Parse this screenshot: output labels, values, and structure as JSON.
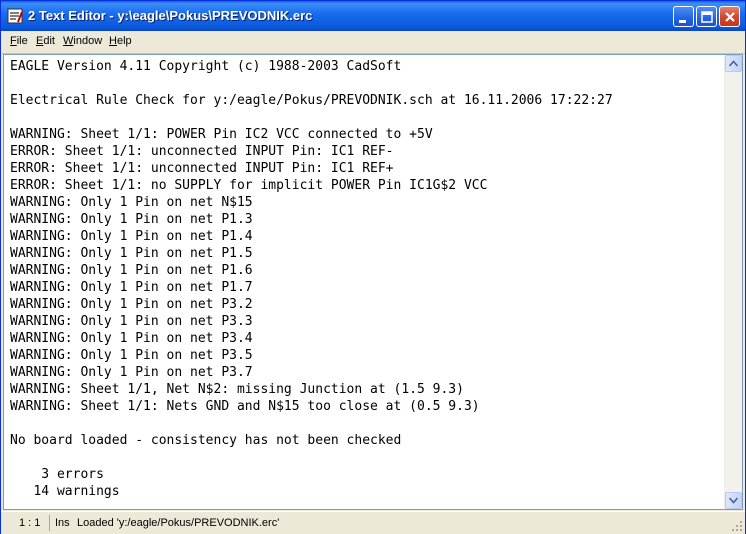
{
  "window": {
    "title": "2 Text Editor - y:\\eagle\\Pokus\\PREVODNIK.erc"
  },
  "menubar": [
    {
      "key": "F",
      "rest": "ile"
    },
    {
      "key": "E",
      "rest": "dit"
    },
    {
      "key": "W",
      "rest": "indow"
    },
    {
      "key": "H",
      "rest": "elp"
    }
  ],
  "editor": {
    "lines": [
      "EAGLE Version 4.11 Copyright (c) 1988-2003 CadSoft",
      "",
      "Electrical Rule Check for y:/eagle/Pokus/PREVODNIK.sch at 16.11.2006 17:22:27",
      "",
      "WARNING: Sheet 1/1: POWER Pin IC2 VCC connected to +5V",
      "ERROR: Sheet 1/1: unconnected INPUT Pin: IC1 REF-",
      "ERROR: Sheet 1/1: unconnected INPUT Pin: IC1 REF+",
      "ERROR: Sheet 1/1: no SUPPLY for implicit POWER Pin IC1G$2 VCC",
      "WARNING: Only 1 Pin on net N$15",
      "WARNING: Only 1 Pin on net P1.3",
      "WARNING: Only 1 Pin on net P1.4",
      "WARNING: Only 1 Pin on net P1.5",
      "WARNING: Only 1 Pin on net P1.6",
      "WARNING: Only 1 Pin on net P1.7",
      "WARNING: Only 1 Pin on net P3.2",
      "WARNING: Only 1 Pin on net P3.3",
      "WARNING: Only 1 Pin on net P3.4",
      "WARNING: Only 1 Pin on net P3.5",
      "WARNING: Only 1 Pin on net P3.7",
      "WARNING: Sheet 1/1, Net N$2: missing Junction at (1.5 9.3)",
      "WARNING: Sheet 1/1: Nets GND and N$15 too close at (0.5 9.3)",
      "",
      "No board loaded - consistency has not been checked",
      "",
      "    3 errors",
      "   14 warnings"
    ]
  },
  "statusbar": {
    "position": "1 : 1",
    "mode": "Ins",
    "message": "Loaded 'y:/eagle/Pokus/PREVODNIK.erc'"
  }
}
